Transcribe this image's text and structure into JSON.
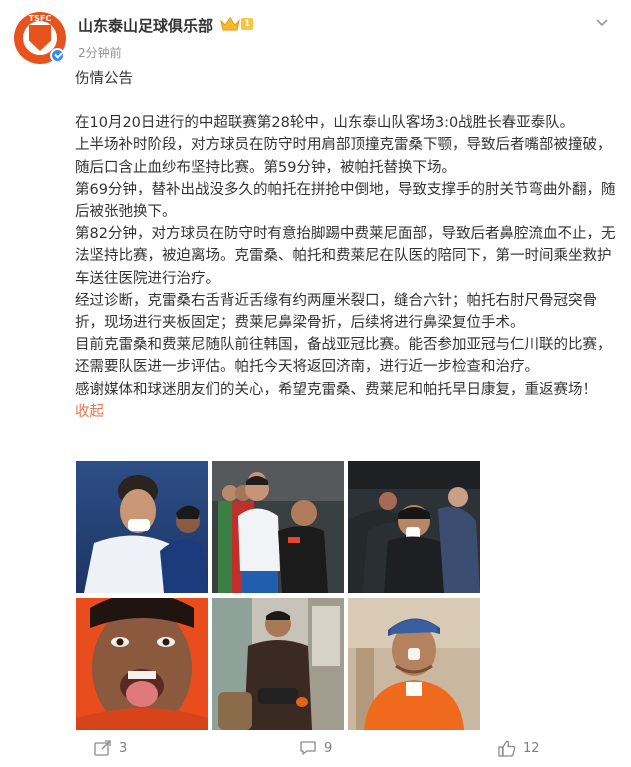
{
  "post": {
    "author_name": "山东泰山足球俱乐部",
    "avatar_abbr": "TSFC",
    "vip_level": "1",
    "time": "2分钟前",
    "title": "伤情公告",
    "paragraphs": [
      "在10月20日进行的中超联赛第28轮中，山东泰山队客场3:0战胜长春亚泰队。",
      "上半场补时阶段，对方球员在防守时用肩部顶撞克雷桑下颚，导致后者嘴部被撞破，随后口含止血纱布坚持比赛。第59分钟，被帕托替换下场。",
      "第69分钟，替补出战没多久的帕托在拼抢中倒地，导致支撑手的肘关节弯曲外翻，随后被张弛换下。",
      "第82分钟，对方球员在防守时有意抬脚踢中费莱尼面部，导致后者鼻腔流血不止，无法坚持比赛，被迫离场。克雷桑、帕托和费莱尼在队医的陪同下，第一时间乘坐救护车送往医院进行治疗。",
      "经过诊断，克雷桑右舌背近舌缘有约两厘米裂口，缝合六针；帕托右肘尺骨冠突骨折，现场进行夹板固定；费莱尼鼻梁骨折，后续将进行鼻梁复位手术。",
      "目前克雷桑和费莱尼随队前往韩国，备战亚冠比赛。能否参加亚冠与仁川联的比赛，还需要队医进一步评估。帕托今天将返回济南，进行近一步检查和治疗。",
      "感谢媒体和球迷朋友们的关心，希望克雷桑、费莱尼和帕托早日康复，重返赛场！"
    ],
    "collapse_label": "收起"
  },
  "actions": {
    "share_count": "3",
    "comment_count": "9",
    "like_count": "12"
  },
  "colors": {
    "link": "#eb7350",
    "brand": "#e8521c",
    "muted": "#939393"
  }
}
